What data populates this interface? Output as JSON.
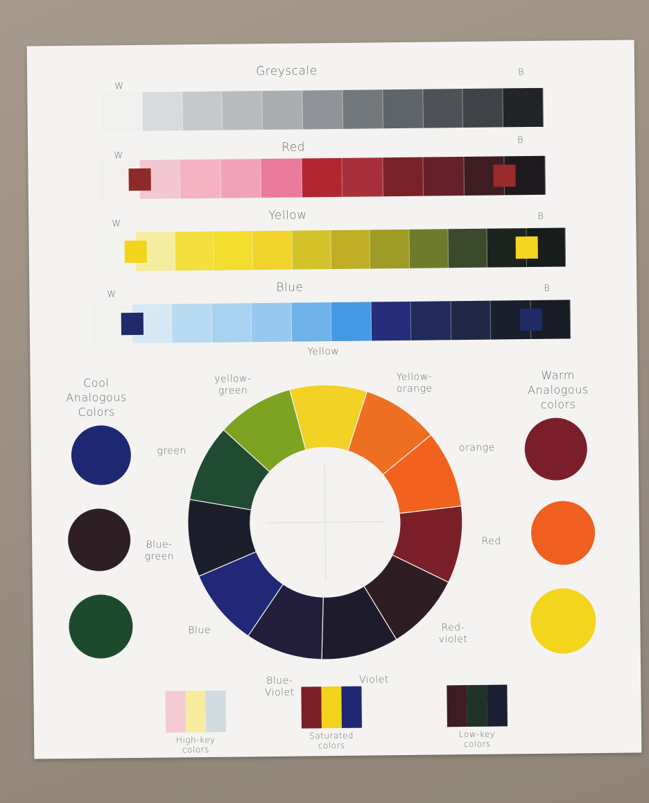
{
  "strips": [
    {
      "title": "Greyscale",
      "left_label": "W",
      "right_label": "B",
      "swatches": [
        "#f0f0ee",
        "#d8dadb",
        "#c6c9cb",
        "#b9bcbe",
        "#a9adb0",
        "#8f9397",
        "#72777b",
        "#5f6469",
        "#4e5257",
        "#3f4347",
        "#222428"
      ],
      "chip_left": null,
      "chip_right": null
    },
    {
      "title": "Red",
      "left_label": "W",
      "right_label": "B",
      "swatches": [
        "#f1f0ee",
        "#f2c7d1",
        "#f4b2c3",
        "#f0a3b8",
        "#e97a9b",
        "#b12630",
        "#a8303a",
        "#7a2127",
        "#65202a",
        "#3e1d22",
        "#1e1a1f"
      ],
      "chip_left": "#8e2b28",
      "chip_right": "#9a2a2c"
    },
    {
      "title": "Yellow",
      "left_label": "W",
      "right_label": "B",
      "swatches": [
        "#f2f2ef",
        "#f6ec9e",
        "#f3df3d",
        "#f3dd2f",
        "#f0d42b",
        "#d4c22a",
        "#bfae25",
        "#a09a26",
        "#6d7b2b",
        "#3c4a2c",
        "#1c231f",
        "#181d1c"
      ],
      "chip_left": "#f2d41c",
      "chip_right": "#f4d621"
    },
    {
      "title": "Blue",
      "left_label": "W",
      "right_label": "B",
      "swatches": [
        "#f1f1ef",
        "#d5e8f4",
        "#b8dbf2",
        "#a7d2f0",
        "#97c9ef",
        "#6fb2ea",
        "#4599e3",
        "#262d7a",
        "#222a5c",
        "#1f2745",
        "#1a1f2d",
        "#191c24"
      ],
      "chip_left": "#1e2a6b",
      "chip_right": "#1f2a66"
    }
  ],
  "wheel": {
    "segments": [
      {
        "name": "Yellow",
        "label": "Yellow",
        "color": "#f1d225"
      },
      {
        "name": "yellow-orange",
        "label": "Yellow-\norange",
        "color": "#ee6f22"
      },
      {
        "name": "orange",
        "label": "orange",
        "color": "#f2621e"
      },
      {
        "name": "red",
        "label": "Red",
        "color": "#7a1f28"
      },
      {
        "name": "red-violet",
        "label": "Red-\nviolet",
        "color": "#2f1d24"
      },
      {
        "name": "violet",
        "label": "Violet",
        "color": "#1e1c2c"
      },
      {
        "name": "blue-violet",
        "label": "Blue-\nViolet",
        "color": "#221e3b"
      },
      {
        "name": "blue",
        "label": "Blue",
        "color": "#202877"
      },
      {
        "name": "blue-green",
        "label": "Blue-\ngreen",
        "color": "#1c1f2b"
      },
      {
        "name": "green",
        "label": "green",
        "color": "#204a32"
      },
      {
        "name": "yellow-green",
        "label": "yellow-\ngreen",
        "color": "#7ca322"
      }
    ]
  },
  "cool": {
    "title": "Cool\nAnalogous\nColors",
    "circles": [
      "#1e2772",
      "#2e1f24",
      "#1d4a2d"
    ]
  },
  "warm": {
    "title": "Warm\nAnalogous\ncolors",
    "circles": [
      "#7a1f2a",
      "#ee5f20",
      "#f2d51c"
    ]
  },
  "schemes": [
    {
      "label": "High-key\ncolors",
      "swatches": [
        "#f4cbd3",
        "#f5eca0",
        "#d1dbe0"
      ]
    },
    {
      "label": "Saturated\ncolors",
      "swatches": [
        "#7a1f28",
        "#f1d21c",
        "#1e2774"
      ]
    },
    {
      "label": "Low-key\ncolors",
      "swatches": [
        "#3d1d24",
        "#1e3326",
        "#1c1f33"
      ]
    }
  ]
}
